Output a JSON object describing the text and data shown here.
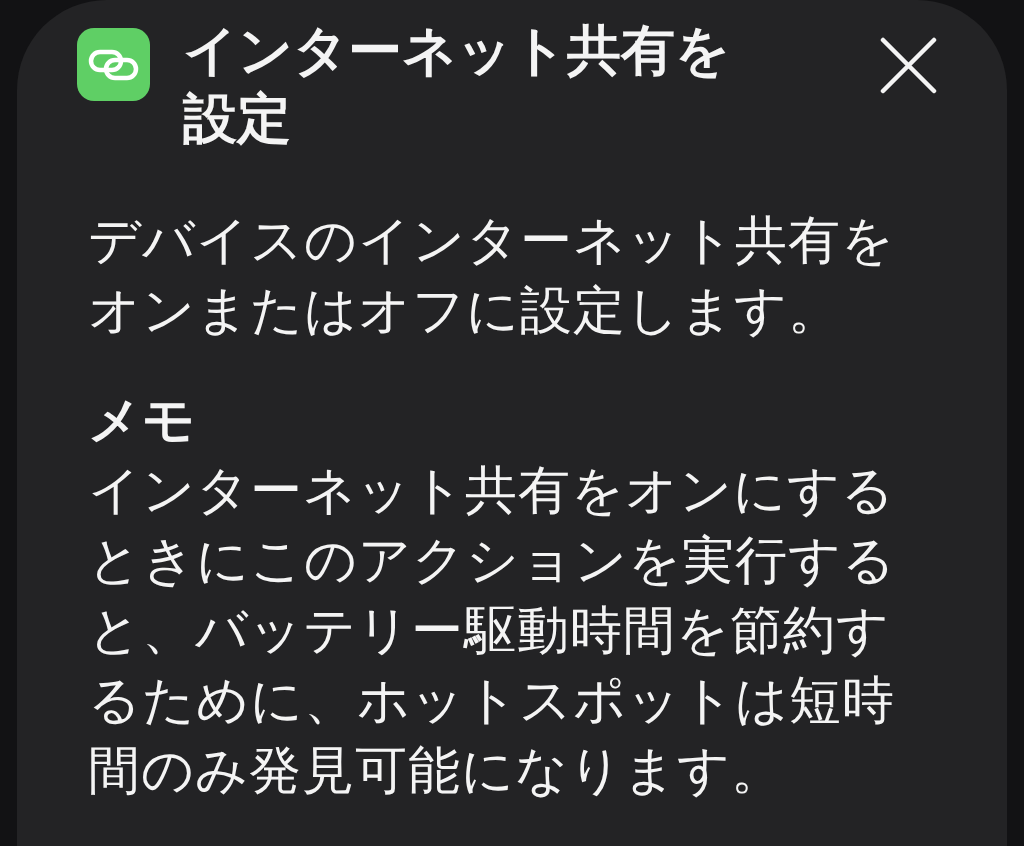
{
  "dialog": {
    "title": "インターネット共有を設定",
    "description": "デバイスのインターネット共有をオンまたはオフに設定します。",
    "note": {
      "heading": "メモ",
      "text": "インターネット共有をオンにするときにこのアクションを実行すると、バッテリー駆動時間を節約するために、ホットスポットは短時間のみ発見可能になります。"
    }
  }
}
